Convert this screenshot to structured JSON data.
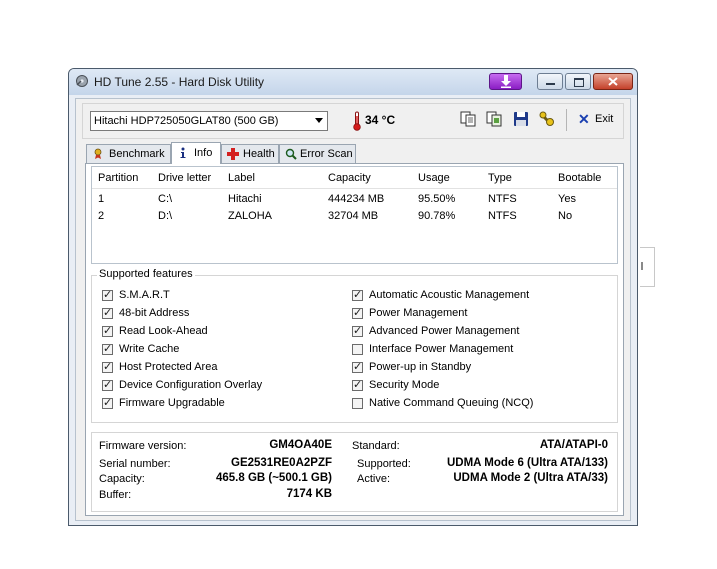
{
  "window": {
    "title": "HD Tune 2.55 - Hard Disk Utility"
  },
  "toolbar": {
    "drive_selected": "Hitachi HDP725050GLAT80 (500 GB)",
    "temperature": "34 °C",
    "exit_label": "Exit",
    "icons": [
      "thermometer-icon",
      "copy-text-icon",
      "copy-screenshot-icon",
      "save-icon",
      "options-icon",
      "exit-x-icon"
    ]
  },
  "tabs": [
    {
      "label": "Benchmark",
      "icon": "benchmark-icon",
      "active": false
    },
    {
      "label": "Info",
      "icon": "info-icon",
      "active": true
    },
    {
      "label": "Health",
      "icon": "health-icon",
      "active": false
    },
    {
      "label": "Error Scan",
      "icon": "error-scan-icon",
      "active": false
    }
  ],
  "partitions": {
    "columns": [
      "Partition",
      "Drive letter",
      "Label",
      "Capacity",
      "Usage",
      "Type",
      "Bootable"
    ],
    "rows": [
      [
        "1",
        "C:\\",
        "Hitachi",
        "444234 MB",
        "95.50%",
        "NTFS",
        "Yes"
      ],
      [
        "2",
        "D:\\",
        "ZALOHA",
        "32704 MB",
        "90.78%",
        "NTFS",
        "No"
      ]
    ]
  },
  "features": {
    "title": "Supported features",
    "left": [
      {
        "label": "S.M.A.R.T",
        "checked": true
      },
      {
        "label": "48-bit Address",
        "checked": true
      },
      {
        "label": "Read Look-Ahead",
        "checked": true
      },
      {
        "label": "Write Cache",
        "checked": true
      },
      {
        "label": "Host Protected Area",
        "checked": true
      },
      {
        "label": "Device Configuration Overlay",
        "checked": true
      },
      {
        "label": "Firmware Upgradable",
        "checked": true
      }
    ],
    "right": [
      {
        "label": "Automatic Acoustic Management",
        "checked": true
      },
      {
        "label": "Power Management",
        "checked": true
      },
      {
        "label": "Advanced Power Management",
        "checked": true
      },
      {
        "label": "Interface Power Management",
        "checked": false
      },
      {
        "label": "Power-up in Standby",
        "checked": true
      },
      {
        "label": "Security Mode",
        "checked": true
      },
      {
        "label": "Native Command Queuing (NCQ)",
        "checked": false
      }
    ]
  },
  "info": {
    "firmware_label": "Firmware version:",
    "firmware_value": "GM4OA40E",
    "serial_label": "Serial number:",
    "serial_value": "GE2531RE0A2PZF",
    "capacity_label": "Capacity:",
    "capacity_value": "465.8 GB (~500.1 GB)",
    "buffer_label": "Buffer:",
    "buffer_value": "7174 KB",
    "standard_label": "Standard:",
    "standard_value": "ATA/ATAPI-0",
    "supported_label": "Supported:",
    "supported_value": "UDMA Mode 6 (Ultra ATA/133)",
    "active_label": "Active:",
    "active_value": "UDMA Mode 2 (Ultra ATA/33)"
  }
}
